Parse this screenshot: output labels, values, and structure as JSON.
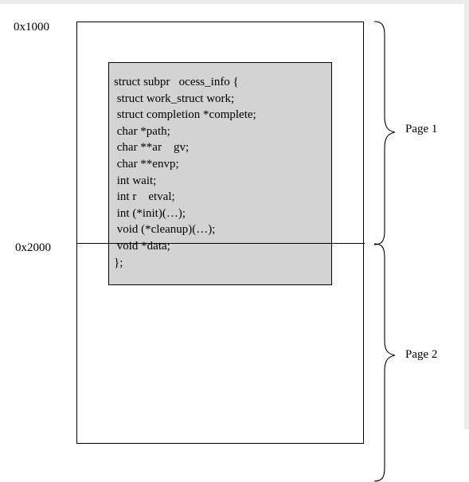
{
  "addresses": {
    "page1_start": "0x1000",
    "page2_start": "0x2000"
  },
  "struct_code": [
    "struct subpr   ocess_info {",
    " struct work_struct work;",
    " struct completion *complete;",
    " char *path;",
    " char **ar    gv;",
    " char **envp;",
    " int wait;",
    " int r    etval;",
    " int (*init)(…);",
    " void (*cleanup)(…);",
    " void *data;",
    "};"
  ],
  "pages": {
    "page1_label": "Page 1",
    "page2_label": "Page 2"
  },
  "colors": {
    "struct_fill": "#d3d3d3",
    "line": "#000000",
    "background": "#ffffff"
  }
}
